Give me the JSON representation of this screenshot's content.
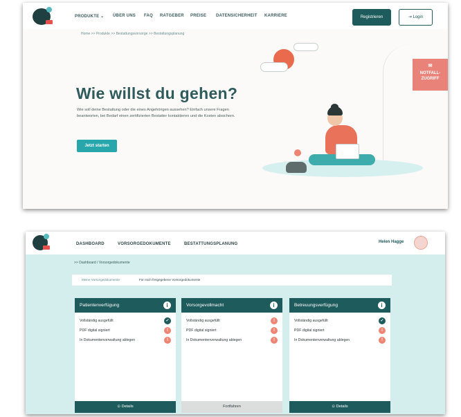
{
  "website": {
    "nav": [
      "PRODUKTE ⌄",
      "ÜBER UNS",
      "FAQ",
      "RATGEBER",
      "PREISE",
      "DATENSICHERHEIT",
      "KARRIERE"
    ],
    "register_label": "Registrieren",
    "login_label": "Login",
    "login_icon": "login-arrow-icon",
    "breadcrumb": "Home  >>  Produkte  >>  Bestattungsvorsorge  >>  Bestattungsplanung",
    "emergency_label_line1": "NOTFALL-",
    "emergency_label_line2": "ZUGRIFF",
    "emergency_icon": "envelope-icon",
    "hero_title": "Wie willst du gehen?",
    "hero_text": "Wie soll deine Bestattung oder die eines Angehörigen aussehen? Einfach unsere Fragen beantworten, bei Bedarf einen zertifizierten Bestatter kontaktieren und die Kosten absichern.",
    "start_label": "Jetzt starten",
    "colors": {
      "primary": "#1e5b5c",
      "accent": "#27a6ac",
      "coral": "#ea6a4e"
    }
  },
  "dashboard": {
    "nav": [
      "DASHBOARD",
      "VORSORGEDOKUMENTE",
      "BESTATTUNGSPLANUNG"
    ],
    "user_name": "Helen Hagge",
    "breadcrumb": ">> Dashboard / Vorsorgedokumente",
    "tabs": [
      "Meine Vorsorgedokumente",
      "Für mich freigegebene Vorsorgedokumente"
    ],
    "cards": [
      {
        "title": "Patientenverfügung",
        "rows": [
          {
            "label": "Vollständig ausgefüllt",
            "status": "ok"
          },
          {
            "label": "PDF digital signiert",
            "status": "todo"
          },
          {
            "label": "In Dokumentenverwaltung ablegen",
            "status": "todo"
          }
        ],
        "action": "⊙  Details"
      },
      {
        "title": "Vorsorgevollmacht",
        "rows": [
          {
            "label": "Vollständig ausgefüllt",
            "status": "todo"
          },
          {
            "label": "PDF digital signiert",
            "status": "todo"
          },
          {
            "label": "In Dokumentenverwaltung ablegen",
            "status": "todo"
          }
        ],
        "action": "Fortfahren"
      },
      {
        "title": "Betreuungsverfügung",
        "rows": [
          {
            "label": "Vollständig ausgefüllt",
            "status": "ok"
          },
          {
            "label": "PDF digital signiert",
            "status": "todo"
          },
          {
            "label": "In Dokumentenverwaltung ablegen",
            "status": "todo"
          }
        ],
        "action": "⊙  Details"
      }
    ],
    "info_symbol": "i",
    "ok_symbol": "✓",
    "todo_symbol": "!"
  }
}
